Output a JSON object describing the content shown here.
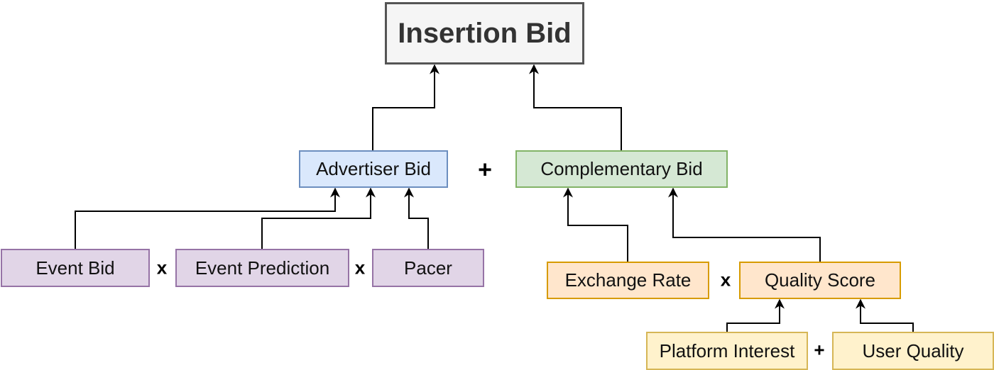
{
  "nodes": {
    "insertion_bid": "Insertion Bid",
    "advertiser_bid": "Advertiser Bid",
    "complementary_bid": "Complementary Bid",
    "event_bid": "Event Bid",
    "event_prediction": "Event Prediction",
    "pacer": "Pacer",
    "exchange_rate": "Exchange Rate",
    "quality_score": "Quality Score",
    "platform_interest": "Platform Interest",
    "user_quality": "User Quality"
  },
  "operators": {
    "advertiser_plus_complementary": "+",
    "event_bid_times_prediction": "x",
    "prediction_times_pacer": "x",
    "exchange_times_quality": "x",
    "platform_plus_user": "+"
  },
  "edges": [
    {
      "from": "Advertiser Bid",
      "to": "Insertion Bid"
    },
    {
      "from": "Complementary Bid",
      "to": "Insertion Bid"
    },
    {
      "from": "Event Bid",
      "to": "Advertiser Bid"
    },
    {
      "from": "Event Prediction",
      "to": "Advertiser Bid"
    },
    {
      "from": "Pacer",
      "to": "Advertiser Bid"
    },
    {
      "from": "Exchange Rate",
      "to": "Complementary Bid"
    },
    {
      "from": "Quality Score",
      "to": "Complementary Bid"
    },
    {
      "from": "Platform Interest",
      "to": "Quality Score"
    },
    {
      "from": "User Quality",
      "to": "Quality Score"
    }
  ],
  "colors": {
    "title_fill": "#f5f5f5",
    "advertiser_fill": "#dae8fc",
    "complementary_fill": "#d5e8d4",
    "advertiser_inputs_fill": "#e1d5e7",
    "complementary_inputs_fill": "#ffe6cc",
    "quality_inputs_fill": "#fff2cc"
  }
}
